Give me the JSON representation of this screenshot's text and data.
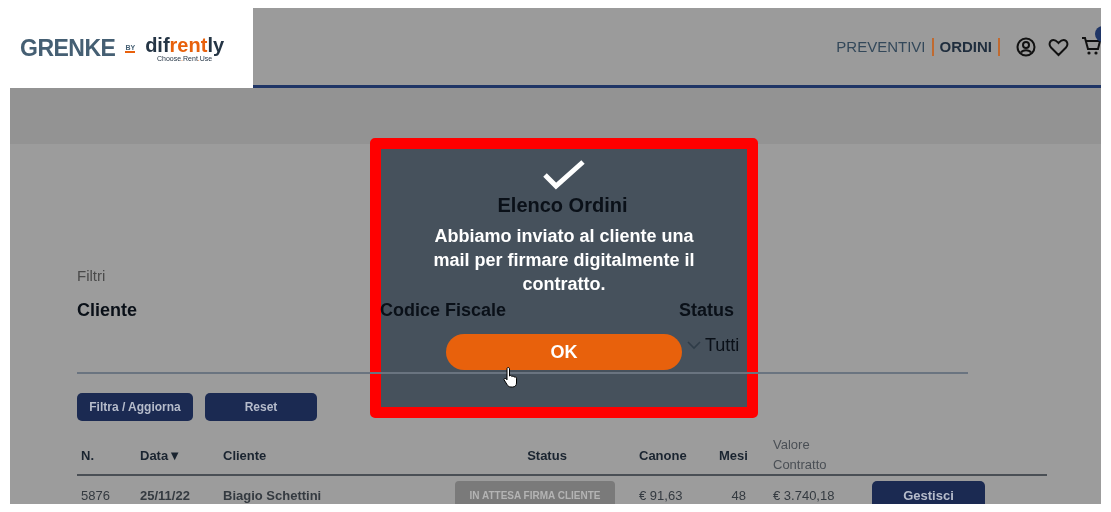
{
  "logo": {
    "brand": "GRENKE",
    "by": "BY",
    "partner_parts": [
      "dif",
      "rent",
      "ly"
    ],
    "tagline": [
      "Choose",
      ".",
      "Rent",
      ".",
      "Use"
    ]
  },
  "nav": {
    "links": [
      {
        "label": "PREVENTIVI",
        "selected": false
      },
      {
        "label": "ORDINI",
        "selected": true
      }
    ],
    "cart_badge": true
  },
  "page_title": "Elenco Ordini",
  "filters": {
    "heading": "Filtri",
    "fields": [
      {
        "label": "Cliente",
        "kind": "text"
      },
      {
        "label": "Codice Fiscale",
        "kind": "text"
      },
      {
        "label": "Status",
        "kind": "select",
        "value": "Tutti"
      }
    ],
    "buttons": [
      "Filtra / Aggiorna",
      "Reset"
    ]
  },
  "table": {
    "columns": [
      "N.",
      "Data▼",
      "Cliente",
      "Status",
      "Canone",
      "Mesi",
      "Valore Contratto"
    ],
    "rows": [
      {
        "number": "5876",
        "date": "25/11/22",
        "client": "Biagio Schettini",
        "status": "IN ATTESA FIRMA CLIENTE",
        "canone": "€ 91,63",
        "mesi": "48",
        "valore": "€ 3.740,18",
        "action": "Gestisci"
      }
    ]
  },
  "dialog": {
    "open": true,
    "message": "Abbiamo inviato al cliente una mail per firmare digitalmente il contratto.",
    "button": "OK"
  }
}
